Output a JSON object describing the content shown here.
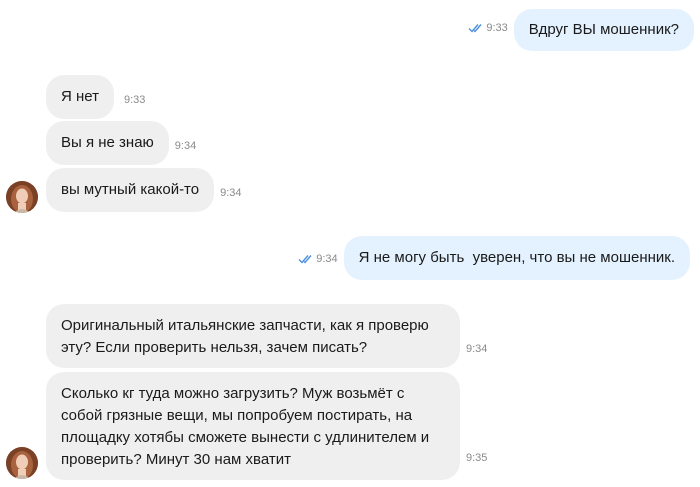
{
  "messages": [
    {
      "id": "m1",
      "direction": "outgoing",
      "text": "Вдруг ВЫ мошенник?",
      "time": "9:33",
      "status": "read"
    },
    {
      "id": "m2",
      "direction": "incoming",
      "text": "Я нет",
      "time": "9:33"
    },
    {
      "id": "m3",
      "direction": "incoming",
      "text": "Вы я не знаю",
      "time": "9:34"
    },
    {
      "id": "m4",
      "direction": "incoming",
      "text": "вы мутный какой-то",
      "time": "9:34"
    },
    {
      "id": "m5",
      "direction": "outgoing",
      "text": "Я не могу быть  уверен, что вы не мошенник.",
      "time": "9:34",
      "status": "read"
    },
    {
      "id": "m6",
      "direction": "incoming",
      "text": "Оригинальный итальянские запчасти, как я проверю эту? Если проверить нельзя, зачем писать?",
      "time": "9:34"
    },
    {
      "id": "m7",
      "direction": "incoming",
      "text": "Сколько кг туда можно загрузить? Муж возьмёт с собой грязные вещи, мы попробуем постирать, на площадку хотябы сможете вынести с удлинителем и проверить? Минут 30 нам хватит",
      "time": "9:35"
    }
  ],
  "icons": {
    "read_receipt": "double-check-icon",
    "avatar": "contact-avatar"
  },
  "colors": {
    "incoming_bubble": "#efefef",
    "outgoing_bubble": "#e3f2fe",
    "read_tick": "#4a90e2",
    "time_text": "#8a8a8a"
  }
}
